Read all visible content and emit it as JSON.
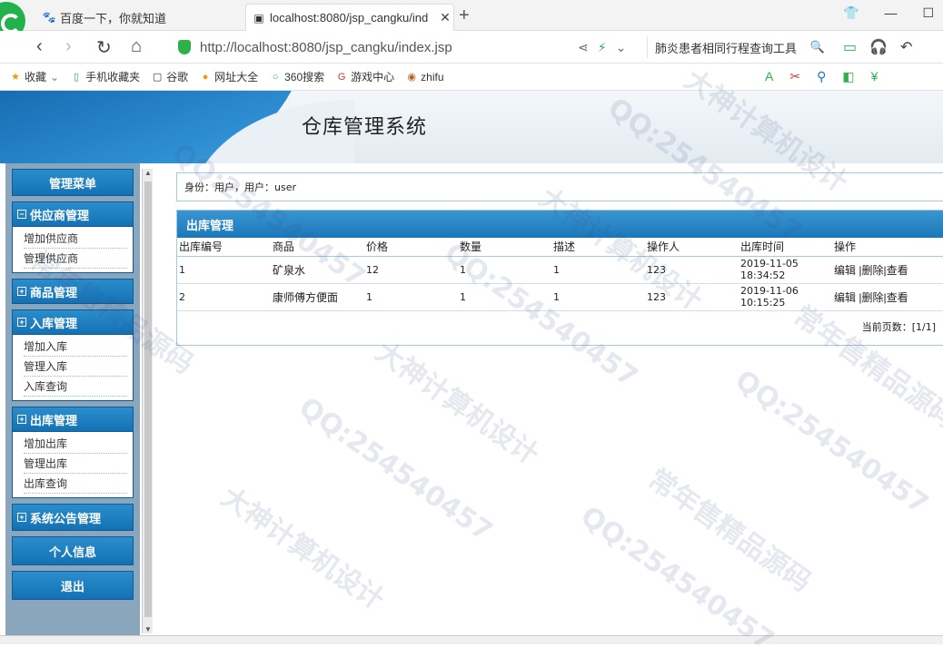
{
  "browser": {
    "tabs": [
      {
        "title": "百度一下，你就知道"
      },
      {
        "title": "localhost:8080/jsp_cangku/ind"
      }
    ],
    "url_host": "http://localhost",
    "url_rest": ":8080/jsp_cangku/index.jsp",
    "search_text": "肺炎患者相同行程查询工具",
    "bookmarks": [
      "收藏",
      "手机收藏夹",
      "谷歌",
      "网址大全",
      "360搜索",
      "游戏中心",
      "zhifu"
    ]
  },
  "app": {
    "title": "仓库管理系统"
  },
  "sidebar": {
    "menu_header": "管理菜单",
    "groups": [
      {
        "label": "供应商管理",
        "expanded": true,
        "items": [
          "增加供应商",
          "管理供应商"
        ]
      },
      {
        "label": "商品管理",
        "expanded": false,
        "items": []
      },
      {
        "label": "入库管理",
        "expanded": true,
        "items": [
          "增加入库",
          "管理入库",
          "入库查询"
        ]
      },
      {
        "label": "出库管理",
        "expanded": true,
        "items": [
          "增加出库",
          "管理出库",
          "出库查询"
        ]
      },
      {
        "label": "系统公告管理",
        "expanded": false,
        "items": []
      }
    ],
    "personal_info": "个人信息",
    "logout": "退出"
  },
  "identity": {
    "text": "身份：用户，用户：user"
  },
  "outbound": {
    "title": "出库管理",
    "columns": [
      "出库编号",
      "商品",
      "价格",
      "数量",
      "描述",
      "操作人",
      "出库时间",
      "操作"
    ],
    "rows": [
      {
        "id": "1",
        "product": "矿泉水",
        "price": "12",
        "qty": "1",
        "desc": "1",
        "operator": "123",
        "time": "2019-11-05\n18:34:52"
      },
      {
        "id": "2",
        "product": "康师傅方便面",
        "price": "1",
        "qty": "1",
        "desc": "1",
        "operator": "123",
        "time": "2019-11-06\n10:15:25"
      }
    ],
    "actions": {
      "edit": "编辑",
      "delete": "|删除",
      "view": "|查看"
    },
    "pager": "当前页数：[1/1]"
  },
  "watermarks": [
    "QQ:254540457",
    "大神计算机设计",
    "常年售精品源码"
  ],
  "colors": {
    "accent": "#1b78b8",
    "sidebar_bg": "#8aa6bd"
  }
}
